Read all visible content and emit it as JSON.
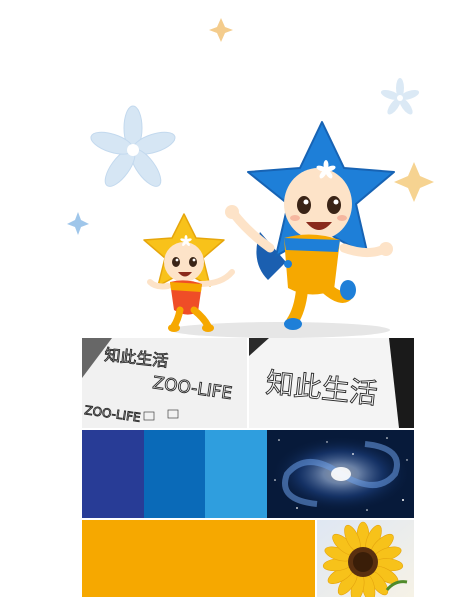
{
  "palette": {
    "navy": "#283c96",
    "blue": "#0a6ab8",
    "sky": "#2f9ede",
    "orange": "#f6a800",
    "mascot_blue": "#1e7fd8",
    "mascot_yellow": "#f8c21a"
  },
  "sketches": {
    "left_line1": "知此生活",
    "left_line2": "ZOO-LIFE",
    "left_line3": "ZOO-LIFE",
    "right_line1": "知此生活"
  },
  "mascots": {
    "large": "star-mascot-blue",
    "small": "star-mascot-yellow"
  },
  "photos": {
    "galaxy": "spiral-galaxy",
    "flower": "sunflower"
  }
}
